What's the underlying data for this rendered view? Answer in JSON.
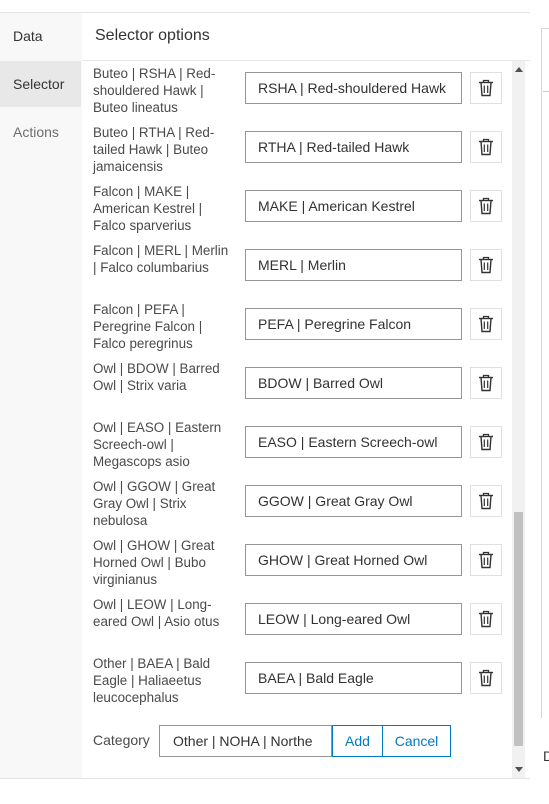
{
  "tabs": {
    "data": "Data",
    "selector": "Selector",
    "actions": "Actions"
  },
  "panel": {
    "title": "Selector options"
  },
  "rows": [
    {
      "label": "Buteo | RSHA | Red-shouldered Hawk | Buteo lineatus",
      "value": "RSHA | Red-shouldered Hawk"
    },
    {
      "label": "Buteo | RTHA | Red-tailed Hawk | Buteo jamaicensis",
      "value": "RTHA | Red-tailed Hawk"
    },
    {
      "label": "Falcon | MAKE | American Kestrel | Falco sparverius",
      "value": "MAKE | American Kestrel"
    },
    {
      "label": "Falcon | MERL | Merlin | Falco columbarius",
      "value": "MERL | Merlin"
    },
    {
      "label": "Falcon | PEFA | Peregrine Falcon | Falco peregrinus",
      "value": "PEFA | Peregrine Falcon"
    },
    {
      "label": "Owl | BDOW | Barred Owl | Strix varia",
      "value": "BDOW | Barred Owl"
    },
    {
      "label": "Owl | EASO | Eastern Screech-owl | Megascops asio",
      "value": "EASO | Eastern Screech-owl"
    },
    {
      "label": "Owl | GGOW | Great Gray Owl | Strix nebulosa",
      "value": "GGOW | Great Gray Owl"
    },
    {
      "label": "Owl | GHOW | Great Horned Owl | Bubo virginianus",
      "value": "GHOW | Great Horned Owl"
    },
    {
      "label": "Owl | LEOW | Long-eared Owl | Asio otus",
      "value": "LEOW | Long-eared Owl"
    },
    {
      "label": "Other | BAEA | Bald Eagle | Haliaeetus leucocephalus",
      "value": "BAEA | Bald Eagle"
    }
  ],
  "footer": {
    "category_label": "Category",
    "category_value": "Other | NOHA | Northe",
    "add_label": "Add",
    "cancel_label": "Cancel"
  },
  "edge": {
    "letter": "D"
  },
  "icons": {
    "delete": "trash-icon",
    "scroll_up": "caret-up-icon",
    "scroll_down": "caret-down-icon"
  },
  "colors": {
    "accent": "#007ac2",
    "selected_tab_bg": "#e8e8e8"
  }
}
